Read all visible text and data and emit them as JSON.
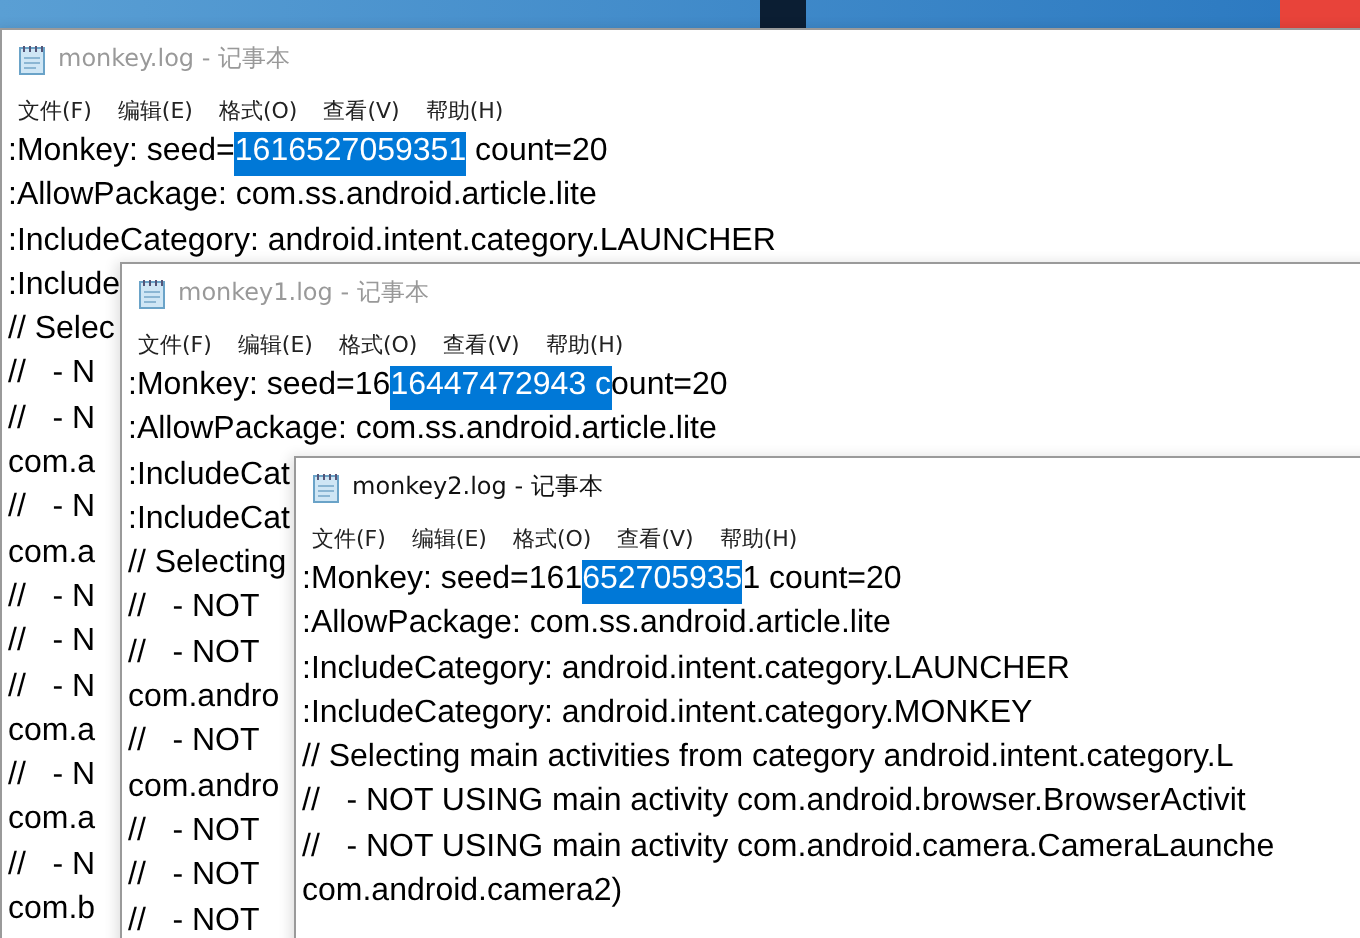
{
  "windows": [
    {
      "title": "monkey.log - 记事本",
      "active": false,
      "menu": [
        "文件(F)",
        "编辑(E)",
        "格式(O)",
        "查看(V)",
        "帮助(H)"
      ],
      "lines": [
        [
          {
            "text": ":Monkey: seed=",
            "selected": false
          },
          {
            "text": "1616527059351",
            "selected": true
          },
          {
            "text": " count=20",
            "selected": false
          }
        ],
        [
          {
            "text": ":AllowPackage: com.ss.android.article.lite",
            "selected": false
          }
        ],
        [
          {
            "text": ":IncludeCategory: android.intent.category.LAUNCHER",
            "selected": false
          }
        ],
        [
          {
            "text": ":Include",
            "selected": false
          }
        ],
        [
          {
            "text": "// Selec",
            "selected": false
          }
        ],
        [
          {
            "text": "//   - N",
            "selected": false
          }
        ],
        [
          {
            "text": "//   - N",
            "selected": false
          }
        ],
        [
          {
            "text": "com.a",
            "selected": false
          }
        ],
        [
          {
            "text": "//   - N",
            "selected": false
          }
        ],
        [
          {
            "text": "com.a",
            "selected": false
          }
        ],
        [
          {
            "text": "//   - N",
            "selected": false
          }
        ],
        [
          {
            "text": "//   - N",
            "selected": false
          }
        ],
        [
          {
            "text": "//   - N",
            "selected": false
          }
        ],
        [
          {
            "text": "com.a",
            "selected": false
          }
        ],
        [
          {
            "text": "//   - N",
            "selected": false
          }
        ],
        [
          {
            "text": "com.a",
            "selected": false
          }
        ],
        [
          {
            "text": "//   - N",
            "selected": false
          }
        ],
        [
          {
            "text": "com.b",
            "selected": false
          }
        ]
      ]
    },
    {
      "title": "monkey1.log - 记事本",
      "active": false,
      "menu": [
        "文件(F)",
        "编辑(E)",
        "格式(O)",
        "查看(V)",
        "帮助(H)"
      ],
      "lines": [
        [
          {
            "text": ":Monkey: seed=16",
            "selected": false
          },
          {
            "text": "16447472943 c",
            "selected": true
          },
          {
            "text": "ount=20",
            "selected": false
          }
        ],
        [
          {
            "text": ":AllowPackage: com.ss.android.article.lite",
            "selected": false
          }
        ],
        [
          {
            "text": ":IncludeCat",
            "selected": false
          }
        ],
        [
          {
            "text": ":IncludeCat",
            "selected": false
          }
        ],
        [
          {
            "text": "// Selecting",
            "selected": false
          }
        ],
        [
          {
            "text": "//   - NOT",
            "selected": false
          }
        ],
        [
          {
            "text": "//   - NOT",
            "selected": false
          }
        ],
        [
          {
            "text": "com.andro",
            "selected": false
          }
        ],
        [
          {
            "text": "//   - NOT",
            "selected": false
          }
        ],
        [
          {
            "text": "com.andro",
            "selected": false
          }
        ],
        [
          {
            "text": "//   - NOT",
            "selected": false
          }
        ],
        [
          {
            "text": "//   - NOT",
            "selected": false
          }
        ],
        [
          {
            "text": "//   - NOT",
            "selected": false
          }
        ]
      ]
    },
    {
      "title": "monkey2.log - 记事本",
      "active": true,
      "menu": [
        "文件(F)",
        "编辑(E)",
        "格式(O)",
        "查看(V)",
        "帮助(H)"
      ],
      "lines": [
        [
          {
            "text": ":Monkey: seed=161",
            "selected": false
          },
          {
            "text": "652705935",
            "selected": true
          },
          {
            "text": "1 count=20",
            "selected": false
          }
        ],
        [
          {
            "text": ":AllowPackage: com.ss.android.article.lite",
            "selected": false
          }
        ],
        [
          {
            "text": ":IncludeCategory: android.intent.category.LAUNCHER",
            "selected": false
          }
        ],
        [
          {
            "text": ":IncludeCategory: android.intent.category.MONKEY",
            "selected": false
          }
        ],
        [
          {
            "text": "// Selecting main activities from category android.intent.category.L",
            "selected": false
          }
        ],
        [
          {
            "text": "//   - NOT USING main activity com.android.browser.BrowserActivit",
            "selected": false
          }
        ],
        [
          {
            "text": "//   - NOT USING main activity com.android.camera.CameraLaunche",
            "selected": false
          }
        ],
        [
          {
            "text": "com.android.camera2)",
            "selected": false
          }
        ]
      ]
    }
  ]
}
